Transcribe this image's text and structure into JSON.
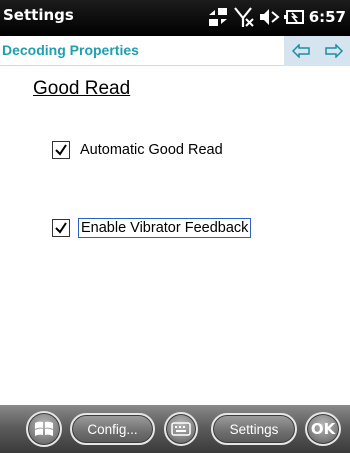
{
  "status_bar": {
    "title": "Settings",
    "time": "6:57",
    "icons": [
      "connectivity-icon",
      "no-signal-icon",
      "volume-muted-icon",
      "battery-charging-icon"
    ]
  },
  "title_bar": {
    "title": "Decoding Properties",
    "nav_icons": [
      "left-arrow-icon",
      "right-arrow-icon"
    ]
  },
  "content": {
    "heading": "Good Read",
    "options": [
      {
        "label": "Automatic Good Read",
        "checked": true
      },
      {
        "label": "Enable Vibrator Feedback",
        "checked": true
      }
    ]
  },
  "bottom_bar": {
    "start_icon": "windows-logo-icon",
    "config_label": "Config...",
    "keyboard_icon": "keyboard-icon",
    "settings_label": "Settings",
    "ok_label": "OK"
  },
  "colors": {
    "title_accent": "#1f9fb0",
    "nav_background": "#d6e4ef",
    "focus_border": "#2a62c9"
  }
}
